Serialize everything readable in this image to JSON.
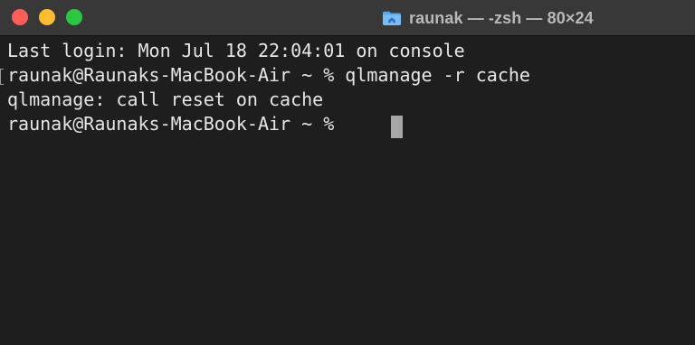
{
  "window": {
    "title": "raunak — -zsh — 80×24",
    "folder_icon": "home-folder-icon",
    "colors": {
      "close": "#ff5f57",
      "minimize": "#febc2e",
      "zoom": "#28c840",
      "background": "#1e1e1f",
      "text": "#e6e6e6",
      "cursor": "#a6a6a6"
    }
  },
  "terminal": {
    "lines": [
      "Last login: Mon Jul 18 22:04:01 on console",
      "raunak@Raunaks-MacBook-Air ~ % qlmanage -r cache",
      "qlmanage: call reset on cache",
      "raunak@Raunaks-MacBook-Air ~ % "
    ]
  }
}
